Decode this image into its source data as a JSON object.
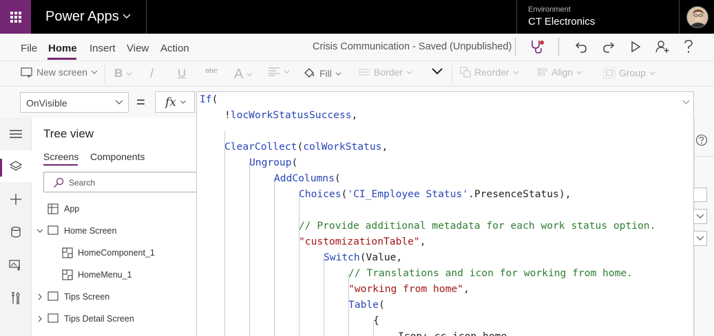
{
  "topbar": {
    "app_name": "Power Apps",
    "environment_label": "Environment",
    "environment_name": "CT Electronics"
  },
  "menu": {
    "items": [
      "File",
      "Home",
      "Insert",
      "View",
      "Action"
    ],
    "active": "Home",
    "document_title": "Crisis Communication - Saved (Unpublished)"
  },
  "ribbon": {
    "new_screen": "New screen",
    "bold": "B",
    "italic": "/",
    "underline": "U",
    "strikethrough": "abc",
    "font_size": "A",
    "fill": "Fill",
    "border": "Border",
    "reorder": "Reorder",
    "align": "Align",
    "group": "Group"
  },
  "formula_bar": {
    "property": "OnVisible",
    "equals": "=",
    "fx_label": "fx"
  },
  "tree": {
    "title": "Tree view",
    "tabs": [
      "Screens",
      "Components"
    ],
    "active_tab": "Screens",
    "search_placeholder": "Search",
    "items": [
      {
        "label": "App",
        "type": "app",
        "indent": 0,
        "expandable": false
      },
      {
        "label": "Home Screen",
        "type": "screen",
        "indent": 0,
        "expandable": true,
        "expanded": true
      },
      {
        "label": "HomeComponent_1",
        "type": "component",
        "indent": 1,
        "expandable": false
      },
      {
        "label": "HomeMenu_1",
        "type": "component",
        "indent": 1,
        "expandable": false
      },
      {
        "label": "Tips Screen",
        "type": "screen",
        "indent": 0,
        "expandable": true,
        "expanded": false
      },
      {
        "label": "Tips Detail Screen",
        "type": "screen",
        "indent": 0,
        "expandable": true,
        "expanded": false
      }
    ]
  },
  "code": {
    "lines": [
      {
        "indent": 0,
        "tokens": [
          [
            "kw",
            "If"
          ],
          [
            "pl",
            "("
          ]
        ]
      },
      {
        "indent": 1,
        "tokens": [
          [
            "pl",
            "!"
          ],
          [
            "kw",
            "locWorkStatusSuccess"
          ],
          [
            "pl",
            ","
          ]
        ]
      },
      {
        "indent": 0,
        "tokens": []
      },
      {
        "indent": 1,
        "tokens": [
          [
            "kw",
            "ClearCollect"
          ],
          [
            "pl",
            "("
          ],
          [
            "kw",
            "colWorkStatus"
          ],
          [
            "pl",
            ","
          ]
        ]
      },
      {
        "indent": 2,
        "tokens": [
          [
            "kw",
            "Ungroup"
          ],
          [
            "pl",
            "("
          ]
        ]
      },
      {
        "indent": 3,
        "tokens": [
          [
            "kw",
            "AddColumns"
          ],
          [
            "pl",
            "("
          ]
        ]
      },
      {
        "indent": 4,
        "tokens": [
          [
            "kw",
            "Choices"
          ],
          [
            "pl",
            "("
          ],
          [
            "kw",
            "'CI_Employee Status'"
          ],
          [
            "pl",
            ".PresenceStatus),"
          ]
        ]
      },
      {
        "indent": 0,
        "tokens": []
      },
      {
        "indent": 4,
        "tokens": [
          [
            "cmt",
            "// Provide additional metadata for each work status option."
          ]
        ]
      },
      {
        "indent": 4,
        "tokens": [
          [
            "str",
            "\"customizationTable\""
          ],
          [
            "pl",
            ","
          ]
        ]
      },
      {
        "indent": 5,
        "tokens": [
          [
            "kw",
            "Switch"
          ],
          [
            "pl",
            "(Value,"
          ]
        ]
      },
      {
        "indent": 6,
        "tokens": [
          [
            "cmt",
            "// Translations and icon for working from home."
          ]
        ]
      },
      {
        "indent": 6,
        "tokens": [
          [
            "str",
            "\"working from home\""
          ],
          [
            "pl",
            ","
          ]
        ]
      },
      {
        "indent": 6,
        "tokens": [
          [
            "kw",
            "Table"
          ],
          [
            "pl",
            "("
          ]
        ]
      },
      {
        "indent": 7,
        "tokens": [
          [
            "pl",
            "{"
          ]
        ]
      },
      {
        "indent": 8,
        "tokens": [
          [
            "pl",
            "Icon: cc_icon_home,"
          ]
        ]
      }
    ]
  },
  "colors": {
    "brand": "#742774",
    "keyword": "#2845b8",
    "string": "#a31515",
    "comment": "#2e7d32"
  }
}
